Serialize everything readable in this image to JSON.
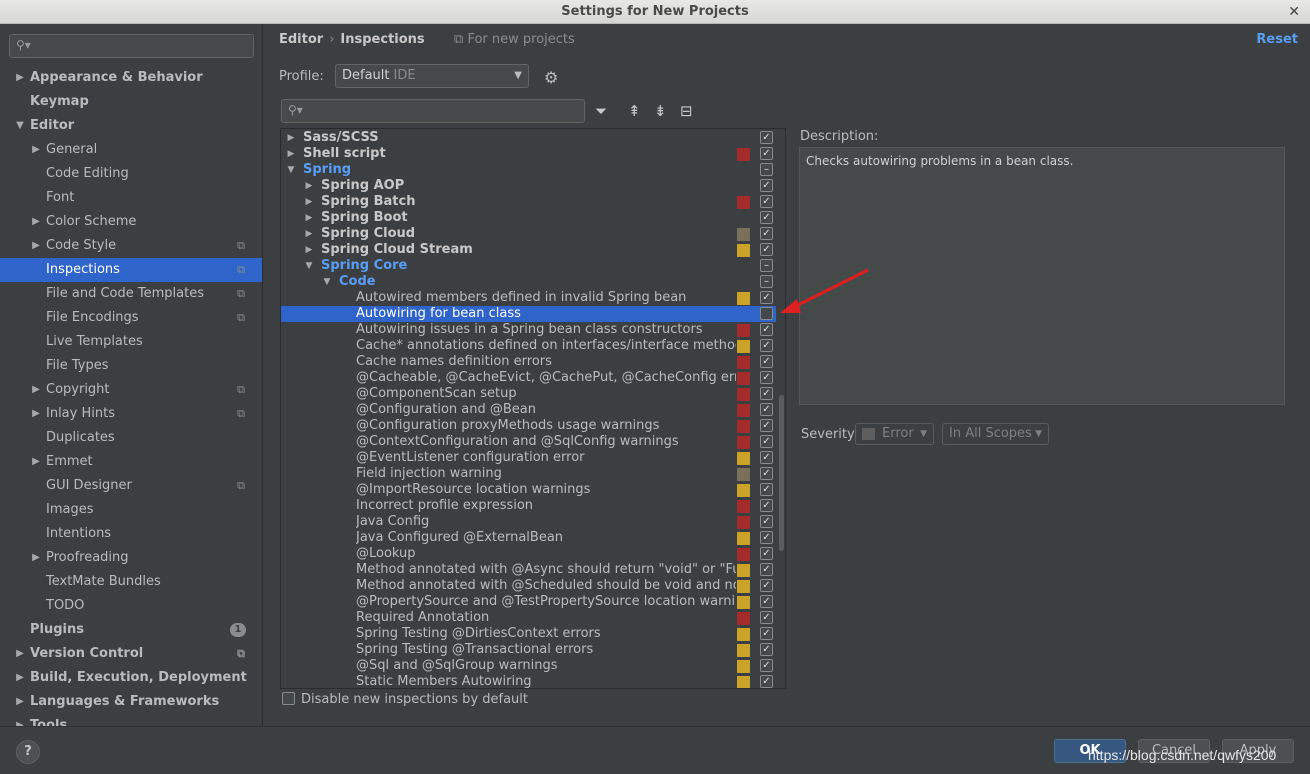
{
  "window": {
    "title": "Settings for New Projects"
  },
  "left": {
    "search_placeholder": "",
    "items": [
      {
        "label": "Appearance & Behavior",
        "level": 0,
        "bold": true,
        "arrow": "right"
      },
      {
        "label": "Keymap",
        "level": 0,
        "bold": true,
        "arrow": ""
      },
      {
        "label": "Editor",
        "level": 0,
        "bold": true,
        "arrow": "down"
      },
      {
        "label": "General",
        "level": 1,
        "arrow": "right"
      },
      {
        "label": "Code Editing",
        "level": 1,
        "arrow": ""
      },
      {
        "label": "Font",
        "level": 1,
        "arrow": ""
      },
      {
        "label": "Color Scheme",
        "level": 1,
        "arrow": "right"
      },
      {
        "label": "Code Style",
        "level": 1,
        "arrow": "right",
        "project_icon": true
      },
      {
        "label": "Inspections",
        "level": 1,
        "arrow": "",
        "project_icon": true,
        "selected": true
      },
      {
        "label": "File and Code Templates",
        "level": 1,
        "arrow": "",
        "project_icon": true
      },
      {
        "label": "File Encodings",
        "level": 1,
        "arrow": "",
        "project_icon": true
      },
      {
        "label": "Live Templates",
        "level": 1,
        "arrow": ""
      },
      {
        "label": "File Types",
        "level": 1,
        "arrow": ""
      },
      {
        "label": "Copyright",
        "level": 1,
        "arrow": "right",
        "project_icon": true
      },
      {
        "label": "Inlay Hints",
        "level": 1,
        "arrow": "right",
        "project_icon": true
      },
      {
        "label": "Duplicates",
        "level": 1,
        "arrow": ""
      },
      {
        "label": "Emmet",
        "level": 1,
        "arrow": "right"
      },
      {
        "label": "GUI Designer",
        "level": 1,
        "arrow": "",
        "project_icon": true
      },
      {
        "label": "Images",
        "level": 1,
        "arrow": ""
      },
      {
        "label": "Intentions",
        "level": 1,
        "arrow": ""
      },
      {
        "label": "Proofreading",
        "level": 1,
        "arrow": "right"
      },
      {
        "label": "TextMate Bundles",
        "level": 1,
        "arrow": ""
      },
      {
        "label": "TODO",
        "level": 1,
        "arrow": ""
      },
      {
        "label": "Plugins",
        "level": 0,
        "bold": true,
        "arrow": "",
        "badge": "1"
      },
      {
        "label": "Version Control",
        "level": 0,
        "bold": true,
        "arrow": "right",
        "project_icon": true
      },
      {
        "label": "Build, Execution, Deployment",
        "level": 0,
        "bold": true,
        "arrow": "right"
      },
      {
        "label": "Languages & Frameworks",
        "level": 0,
        "bold": true,
        "arrow": "right"
      },
      {
        "label": "Tools",
        "level": 0,
        "bold": true,
        "arrow": "right"
      }
    ]
  },
  "header": {
    "breadcrumb_1": "Editor",
    "breadcrumb_sep": "›",
    "breadcrumb_2": "Inspections",
    "for_new": "For new projects",
    "reset": "Reset"
  },
  "profile": {
    "label": "Profile:",
    "value": "Default",
    "suffix": "IDE"
  },
  "colors": {
    "error": "#a52a2a",
    "warning": "#c9a227",
    "weak": "#7a6f5a",
    "accent": "#2f65ca"
  },
  "tree": [
    {
      "label": "Sass/SCSS",
      "level": 0,
      "arrow": "right",
      "style": "bold",
      "sev": "",
      "check": "checked"
    },
    {
      "label": "Shell script",
      "level": 0,
      "arrow": "right",
      "style": "bold",
      "sev": "error",
      "check": "checked"
    },
    {
      "label": "Spring",
      "level": 0,
      "arrow": "down",
      "style": "blue",
      "sev": "",
      "check": "mixed"
    },
    {
      "label": "Spring AOP",
      "level": 1,
      "arrow": "right",
      "style": "bold",
      "sev": "",
      "check": "checked"
    },
    {
      "label": "Spring Batch",
      "level": 1,
      "arrow": "right",
      "style": "bold",
      "sev": "error",
      "check": "checked"
    },
    {
      "label": "Spring Boot",
      "level": 1,
      "arrow": "right",
      "style": "bold",
      "sev": "",
      "check": "checked"
    },
    {
      "label": "Spring Cloud",
      "level": 1,
      "arrow": "right",
      "style": "bold",
      "sev": "weak",
      "check": "checked"
    },
    {
      "label": "Spring Cloud Stream",
      "level": 1,
      "arrow": "right",
      "style": "bold",
      "sev": "warning",
      "check": "checked"
    },
    {
      "label": "Spring Core",
      "level": 1,
      "arrow": "down",
      "style": "blue",
      "sev": "",
      "check": "mixed"
    },
    {
      "label": "Code",
      "level": 2,
      "arrow": "down",
      "style": "blue",
      "sev": "",
      "check": "mixed"
    },
    {
      "label": "Autowired members defined in invalid Spring bean",
      "level": 3,
      "sev": "warning",
      "check": "checked"
    },
    {
      "label": "Autowiring for bean class",
      "level": 3,
      "sev": "",
      "check": "empty",
      "selected": true
    },
    {
      "label": "Autowiring issues in a Spring bean class constructors",
      "level": 3,
      "sev": "error",
      "check": "checked"
    },
    {
      "label": "Cache* annotations defined on interfaces/interface methods",
      "level": 3,
      "sev": "warning",
      "check": "checked"
    },
    {
      "label": "Cache names definition errors",
      "level": 3,
      "sev": "error",
      "check": "checked"
    },
    {
      "label": "@Cacheable, @CacheEvict, @CachePut, @CacheConfig errors",
      "level": 3,
      "sev": "error",
      "check": "checked"
    },
    {
      "label": "@ComponentScan setup",
      "level": 3,
      "sev": "error",
      "check": "checked"
    },
    {
      "label": "@Configuration and @Bean",
      "level": 3,
      "sev": "error",
      "check": "checked"
    },
    {
      "label": "@Configuration proxyMethods usage warnings",
      "level": 3,
      "sev": "error",
      "check": "checked"
    },
    {
      "label": "@ContextConfiguration and @SqlConfig warnings",
      "level": 3,
      "sev": "error",
      "check": "checked"
    },
    {
      "label": "@EventListener configuration error",
      "level": 3,
      "sev": "warning",
      "check": "checked"
    },
    {
      "label": "Field injection warning",
      "level": 3,
      "sev": "weak",
      "check": "checked"
    },
    {
      "label": "@ImportResource location warnings",
      "level": 3,
      "sev": "warning",
      "check": "checked"
    },
    {
      "label": "Incorrect profile expression",
      "level": 3,
      "sev": "error",
      "check": "checked"
    },
    {
      "label": "Java Config",
      "level": 3,
      "sev": "error",
      "check": "checked"
    },
    {
      "label": "Java Configured @ExternalBean",
      "level": 3,
      "sev": "warning",
      "check": "checked"
    },
    {
      "label": "@Lookup",
      "level": 3,
      "sev": "error",
      "check": "checked"
    },
    {
      "label": "Method annotated with @Async should return \"void\" or \"Future-l",
      "level": 3,
      "sev": "warning",
      "check": "checked"
    },
    {
      "label": "Method annotated with @Scheduled should be void and no-args",
      "level": 3,
      "sev": "warning",
      "check": "checked"
    },
    {
      "label": "@PropertySource and @TestPropertySource location warnings",
      "level": 3,
      "sev": "warning",
      "check": "checked"
    },
    {
      "label": "Required Annotation",
      "level": 3,
      "sev": "error",
      "check": "checked"
    },
    {
      "label": "Spring Testing @DirtiesContext errors",
      "level": 3,
      "sev": "warning",
      "check": "checked"
    },
    {
      "label": "Spring Testing @Transactional errors",
      "level": 3,
      "sev": "warning",
      "check": "checked"
    },
    {
      "label": "@Sql and @SqlGroup warnings",
      "level": 3,
      "sev": "warning",
      "check": "checked"
    },
    {
      "label": "Static Members Autowiring",
      "level": 3,
      "sev": "warning",
      "check": "checked"
    }
  ],
  "description": {
    "label": "Description:",
    "text": "Checks autowiring problems in a bean class."
  },
  "severity": {
    "label": "Severity:",
    "value": "Error",
    "scope": "In All Scopes"
  },
  "disable_new": "Disable new inspections by default",
  "buttons": {
    "help": "?",
    "ok": "OK",
    "cancel": "Cancel",
    "apply": "Apply"
  },
  "watermark": "https://blog.csdn.net/qwfys200"
}
